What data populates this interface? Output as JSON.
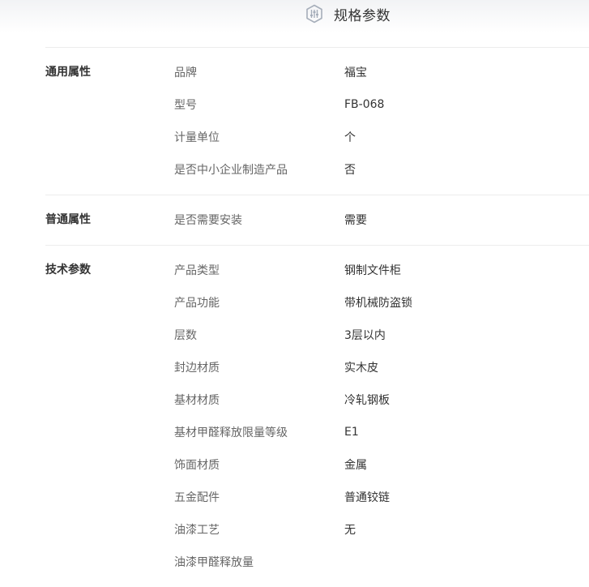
{
  "header": {
    "title": "规格参数",
    "icon": "sliders-hexagon-icon"
  },
  "colors": {
    "group_label": "#333333",
    "key_text": "#666666",
    "value_text": "#333333",
    "divider": "#ececec",
    "icon": "#a6aeba"
  },
  "groups": [
    {
      "label": "通用属性",
      "rows": [
        {
          "key": "品牌",
          "value": "福宝"
        },
        {
          "key": "型号",
          "value": "FB-068"
        },
        {
          "key": "计量单位",
          "value": "个"
        },
        {
          "key": "是否中小企业制造产品",
          "value": "否"
        }
      ]
    },
    {
      "label": "普通属性",
      "rows": [
        {
          "key": "是否需要安装",
          "value": "需要"
        }
      ]
    },
    {
      "label": "技术参数",
      "rows": [
        {
          "key": "产品类型",
          "value": "钢制文件柜"
        },
        {
          "key": "产品功能",
          "value": "带机械防盗锁"
        },
        {
          "key": "层数",
          "value": "3层以内"
        },
        {
          "key": "封边材质",
          "value": "实木皮"
        },
        {
          "key": "基材材质",
          "value": "冷轧钢板"
        },
        {
          "key": "基材甲醛释放限量等级",
          "value": "E1"
        },
        {
          "key": "饰面材质",
          "value": "金属"
        },
        {
          "key": "五金配件",
          "value": "普通铰链"
        },
        {
          "key": "油漆工艺",
          "value": "无"
        },
        {
          "key": "油漆甲醛释放量",
          "value": ""
        }
      ]
    }
  ]
}
